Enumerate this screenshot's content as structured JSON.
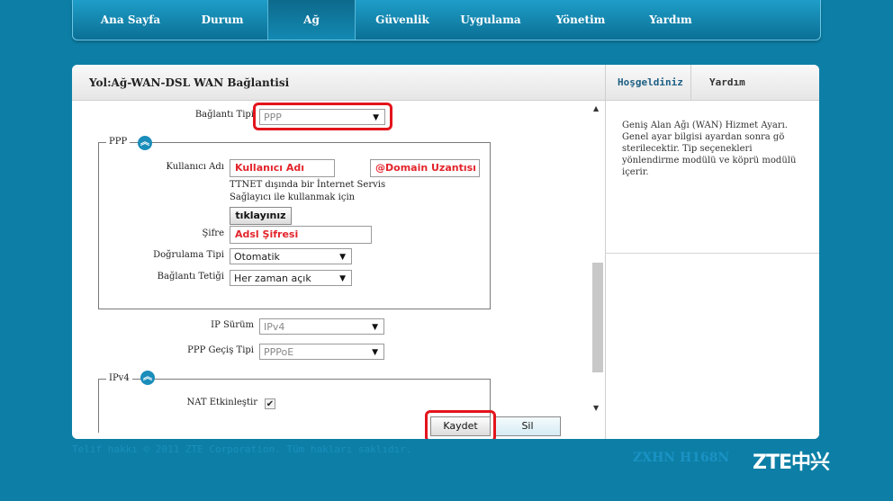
{
  "nav": {
    "tabs": [
      {
        "label": "Ana Sayfa"
      },
      {
        "label": "Durum"
      },
      {
        "label": "Ağ",
        "active": true
      },
      {
        "label": "Güvenlik"
      },
      {
        "label": "Uygulama"
      },
      {
        "label": "Yönetim"
      },
      {
        "label": "Yardım"
      }
    ]
  },
  "breadcrumb": "Yol:Ağ-WAN-DSL WAN Bağlantisi",
  "right_panel": {
    "tabs": [
      "Hoşgeldiniz",
      "Yardım"
    ],
    "description": "Geniş Alan Ağı (WAN) Hizmet Ayarı. Genel ayar bilgisi ayardan sonra gö sterilecektir. Tip seçenekleri yönlendirme modülü ve köprü modülü içerir."
  },
  "form": {
    "connection_type_label": "Bağlantı Tipi",
    "connection_type_value": "PPP",
    "ppp_legend": "PPP",
    "username_label": "Kullanıcı Adı",
    "username_value": "Kullanıcı Adı",
    "domain_value": "@Domain Uzantısı",
    "ttnet_note_1": "TTNET dışında bir İnternet Servis",
    "ttnet_note_2": "Sağlayıcı ile kullanmak için",
    "click_button": "tıklayınız",
    "password_label": "Şifre",
    "password_value": "Adsl Şifresi",
    "auth_type_label": "Doğrulama Tipi",
    "auth_type_value": "Otomatik",
    "trigger_label": "Bağlantı Tetiği",
    "trigger_value": "Her zaman açık",
    "ip_version_label": "IP Sürüm",
    "ip_version_value": "IPv4",
    "ppp_pass_label": "PPP Geçiş Tipi",
    "ppp_pass_value": "PPPoE",
    "ipv4_legend": "IPv4",
    "nat_label": "NAT Etkinleştir",
    "nat_checked": "✔"
  },
  "buttons": {
    "save": "Kaydet",
    "delete": "Sil"
  },
  "footer": {
    "copyright": "Telif hakkı © 2011 ZTE Corporation. Tüm hakları saklıdır.",
    "model": "ZXHN H168N",
    "brand": "ZTE中兴"
  },
  "colors": {
    "background": "#0d7fa6",
    "highlight": "#e3141c",
    "accent": "#1b8dbb"
  }
}
